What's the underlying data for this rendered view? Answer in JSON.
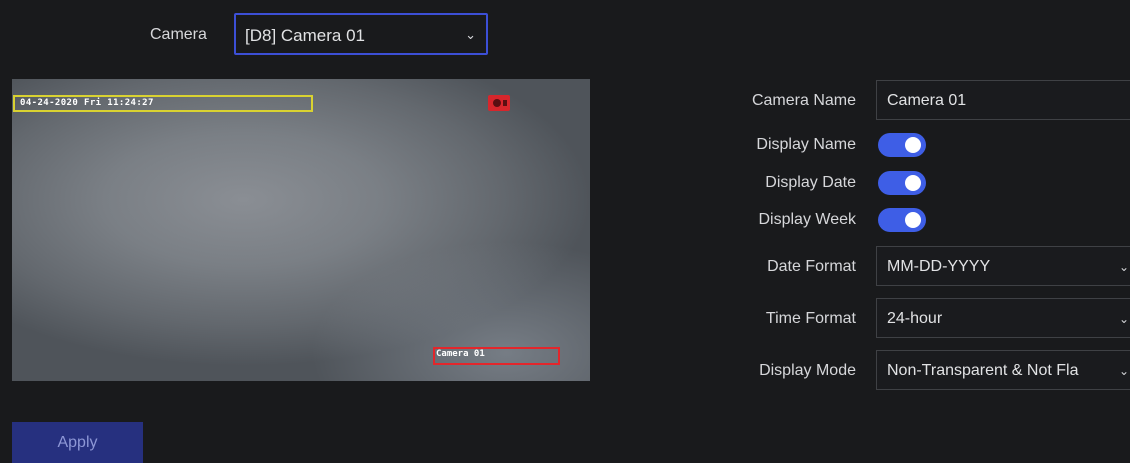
{
  "camera": {
    "label": "Camera",
    "selected": "[D8] Camera 01"
  },
  "preview": {
    "osd_datetime": "04-24-2020 Fri 11:24:27",
    "osd_camera_name": "Camera 01"
  },
  "form": {
    "camera_name": {
      "label": "Camera Name",
      "value": "Camera 01"
    },
    "display_name": {
      "label": "Display Name",
      "enabled": true
    },
    "display_date": {
      "label": "Display Date",
      "enabled": true
    },
    "display_week": {
      "label": "Display Week",
      "enabled": true
    },
    "date_format": {
      "label": "Date Format",
      "value": "MM-DD-YYYY"
    },
    "time_format": {
      "label": "Time Format",
      "value": "24-hour"
    },
    "display_mode": {
      "label": "Display Mode",
      "value": "Non-Transparent & Not Fla"
    }
  },
  "actions": {
    "apply_label": "Apply"
  },
  "colors": {
    "background": "#191a1c",
    "accent": "#3e5ee6",
    "select_border": "#3c4fd6",
    "osd_date_box": "#d9d231",
    "osd_name_box": "#e3262b",
    "apply_button": "#26307f"
  }
}
